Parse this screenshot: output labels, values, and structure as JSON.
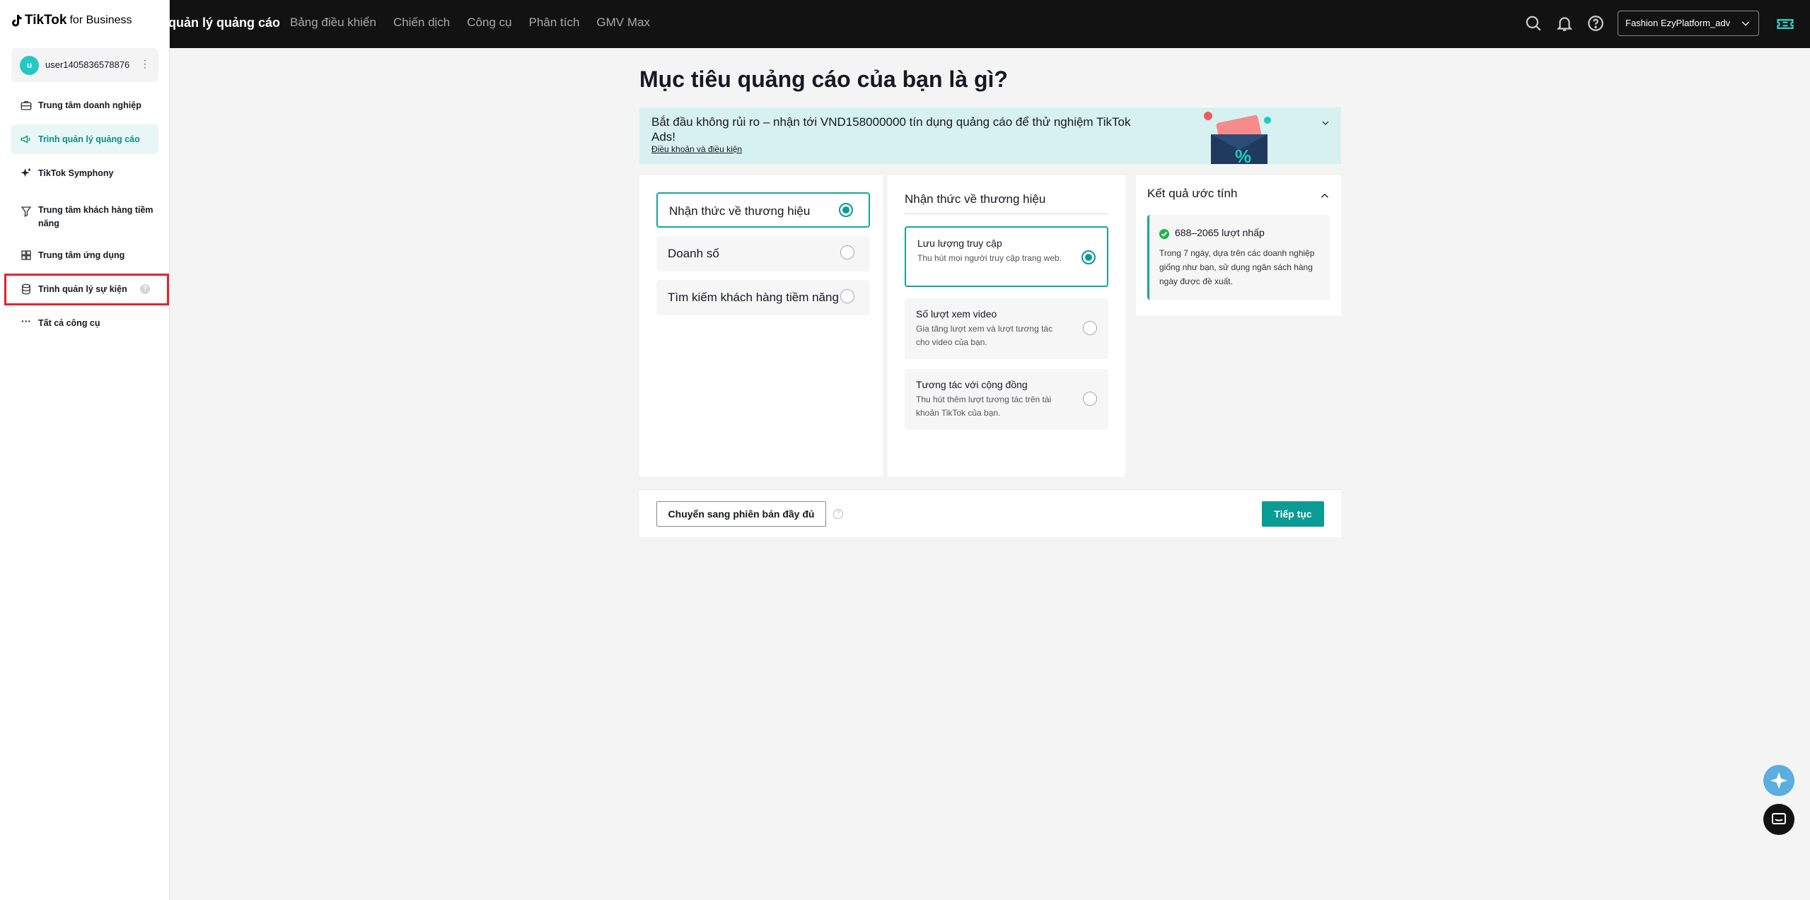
{
  "brand": {
    "logo_main": "TikTok",
    "logo_sub": "for Business"
  },
  "header": {
    "app_title": "quản lý quảng cáo",
    "nav": [
      "Bảng điều khiển",
      "Chiến dịch",
      "Công cụ",
      "Phân tích",
      "GMV Max"
    ],
    "account_selector": "Fashion EzyPlatform_adv"
  },
  "sidebar": {
    "user": {
      "avatar_letter": "u",
      "name": "user1405836578876"
    },
    "items": [
      {
        "label": "Trung tâm doanh nghiệp",
        "icon": "briefcase-icon"
      },
      {
        "label": "Trình quản lý quảng cáo",
        "icon": "megaphone-icon",
        "active": true
      },
      {
        "label": "TikTok Symphony",
        "icon": "sparkle-icon"
      },
      {
        "label": "Trung tâm khách hàng tiềm năng",
        "icon": "funnel-icon"
      },
      {
        "label": "Trung tâm ứng dụng",
        "icon": "grid-icon"
      },
      {
        "label": "Trình quản lý sự kiện",
        "icon": "database-icon",
        "highlighted": true
      },
      {
        "label": "Tất cả công cụ",
        "icon": "ellipsis-icon"
      }
    ]
  },
  "main": {
    "title": "Mục tiêu quảng cáo của bạn là gì?",
    "promo": {
      "text": "Bắt đầu không rủi ro – nhận tới VND158000000 tín dụng quảng cáo để thử nghiệm TikTok Ads!",
      "link": "Điều khoản và điều kiện",
      "badge": "%"
    },
    "goals": [
      {
        "label": "Nhận thức về thương hiệu",
        "selected": true
      },
      {
        "label": "Doanh số",
        "selected": false
      },
      {
        "label": "Tìm kiếm khách hàng tiềm năng",
        "selected": false
      }
    ],
    "sub_panel": {
      "title": "Nhận thức về thương hiệu",
      "options": [
        {
          "title": "Lưu lượng truy cập",
          "desc": "Thu hút mọi người truy cập trang web.",
          "selected": true
        },
        {
          "title": "Số lượt xem video",
          "desc": "Gia tăng lượt xem và lượt tương tác cho video của bạn.",
          "selected": false
        },
        {
          "title": "Tương tác với cộng đồng",
          "desc": "Thu hút thêm lượt tương tác trên tài khoản TikTok của bạn.",
          "selected": false
        }
      ]
    },
    "estimate": {
      "title": "Kết quả ước tính",
      "result": "688–2065 lượt nhấp",
      "desc": "Trong 7 ngày, dựa trên các doanh nghiệp giống như bạn, sử dụng ngân sách hàng ngày được đề xuất."
    },
    "footer": {
      "switch_label": "Chuyển sang phiên bản đầy đủ",
      "continue_label": "Tiếp tục"
    }
  },
  "colors": {
    "accent": "#0a9b94",
    "highlight": "#e5222b",
    "topbar": "#121212"
  }
}
